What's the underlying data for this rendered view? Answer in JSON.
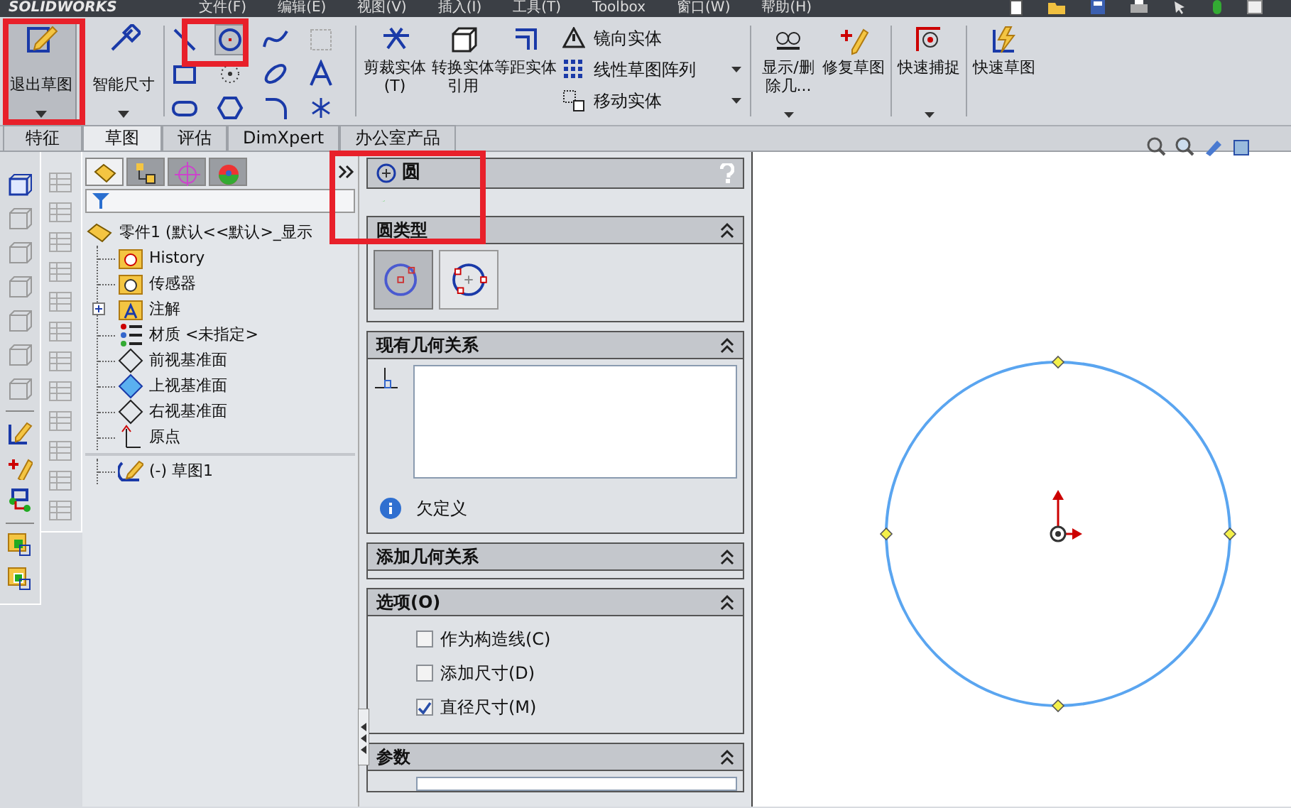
{
  "menu_bar": {
    "logo": "SOLIDWORKS",
    "items": [
      "文件(F)",
      "编辑(E)",
      "视图(V)",
      "插入(I)",
      "工具(T)",
      "Toolbox",
      "窗口(W)",
      "帮助(H)"
    ]
  },
  "toolbar": {
    "large_buttons": [
      {
        "label": "退出草图",
        "selected": true
      },
      {
        "label": "智能尺寸",
        "selected": false
      }
    ],
    "sketch_tools": [
      {
        "selected": false
      },
      {
        "selected": true
      },
      {
        "selected": false
      },
      {
        "selected": false
      },
      {
        "selected": false
      },
      {
        "selected": false
      },
      {
        "selected": false
      },
      {
        "selected": false
      },
      {
        "selected": false
      },
      {
        "selected": false
      },
      {
        "selected": false
      },
      {
        "selected": false
      }
    ],
    "medium_buttons": [
      "剪裁实体(T)",
      "转换实体引用",
      "等距实体"
    ],
    "list_buttons": [
      "镜向实体",
      "线性草图阵列",
      "移动实体"
    ],
    "right_buttons": [
      "显示/删除几...",
      "修复草图",
      "快速捕捉",
      "快速草图"
    ]
  },
  "tabs": [
    {
      "label": "特征",
      "selected": false
    },
    {
      "label": "草图",
      "selected": true
    },
    {
      "label": "评估",
      "selected": false
    },
    {
      "label": "DimXpert",
      "selected": false
    },
    {
      "label": "办公室产品",
      "selected": false
    }
  ],
  "feature_tree": {
    "panel_tabs": [
      {
        "selected": true
      },
      {
        "selected": false
      },
      {
        "selected": false
      },
      {
        "selected": false
      }
    ],
    "root": "零件1  (默认<<默认>_显示",
    "children": [
      {
        "label": "History"
      },
      {
        "label": "传感器"
      },
      {
        "label": "注解",
        "expanded": false
      },
      {
        "label": "材质 <未指定>"
      },
      {
        "label": "前视基准面"
      },
      {
        "label": "上视基准面"
      },
      {
        "label": "右视基准面"
      },
      {
        "label": "原点"
      },
      {
        "label": "(-) 草图1"
      }
    ]
  },
  "property_manager": {
    "title": "圆",
    "circle_type": {
      "title": "圆类型",
      "options": [
        {
          "selected": true
        },
        {
          "selected": false
        }
      ]
    },
    "existing_relations": {
      "title": "现有几何关系",
      "status": "欠定义"
    },
    "add_relations": {
      "title": "添加几何关系"
    },
    "options": {
      "title": "选项(O)",
      "items": [
        {
          "label": "作为构造线(C)",
          "checked": false
        },
        {
          "label": "添加尺寸(D)",
          "checked": false
        },
        {
          "label": "直径尺寸(M)",
          "checked": true
        }
      ]
    },
    "parameters": {
      "title": "参数"
    }
  }
}
